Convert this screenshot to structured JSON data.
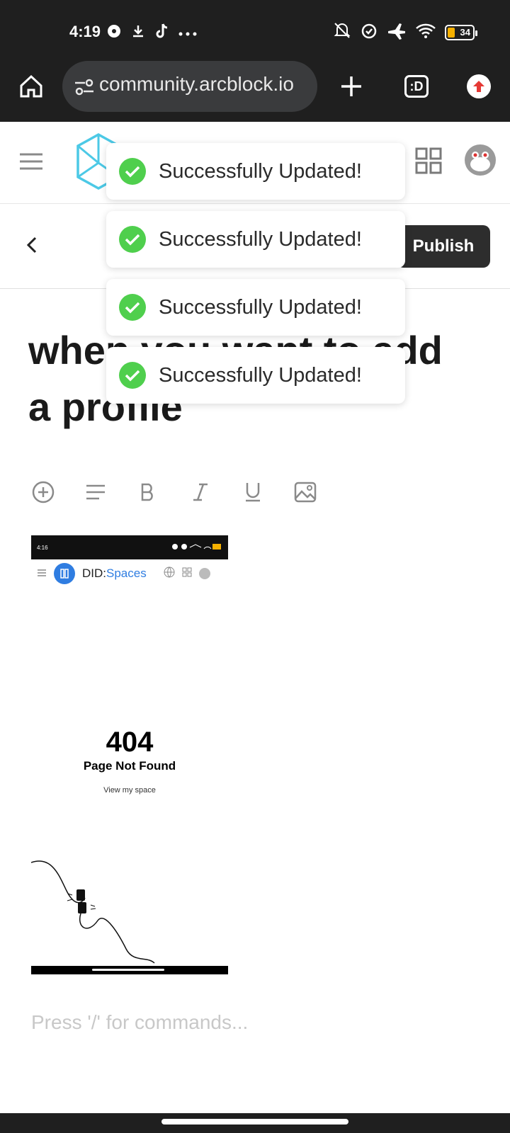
{
  "status_bar": {
    "time": "4:19",
    "battery": "34"
  },
  "browser": {
    "url": "community.arcblock.io",
    "tab_label": ":D"
  },
  "editor": {
    "publish_label": "Publish",
    "title": "when you want to add a profile",
    "placeholder": "Press '/' for commands..."
  },
  "embedded_screenshot": {
    "time": "4:16",
    "app_name": "DID:",
    "app_name_accent": "Spaces",
    "error_code": "404",
    "error_message": "Page Not Found",
    "link_text": "View my space"
  },
  "toasts": [
    {
      "message": "Successfully Updated!"
    },
    {
      "message": "Successfully Updated!"
    },
    {
      "message": "Successfully Updated!"
    },
    {
      "message": "Successfully Updated!"
    }
  ],
  "colors": {
    "success": "#4fcf4d",
    "dark": "#2d2d2d",
    "logo": "#4cc9e6"
  }
}
